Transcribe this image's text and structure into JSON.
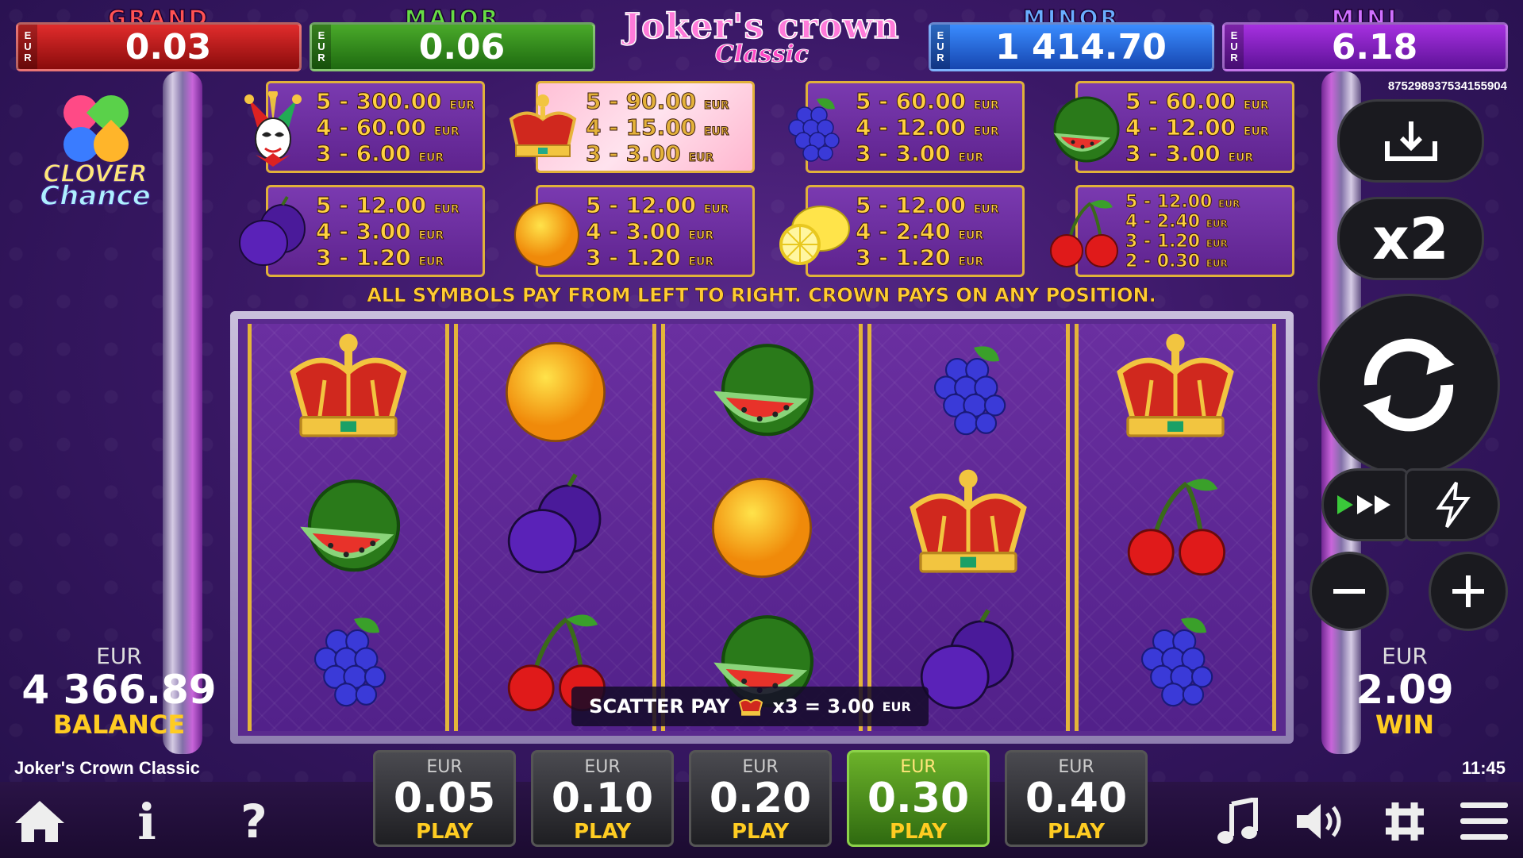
{
  "jackpots": [
    {
      "name": "GRAND",
      "currency_top": "E",
      "currency_mid": "U",
      "currency_bot": "R",
      "value": "0.03"
    },
    {
      "name": "MAJOR",
      "currency_top": "E",
      "currency_mid": "U",
      "currency_bot": "R",
      "value": "0.06"
    },
    {
      "name": "MINOR",
      "currency_top": "E",
      "currency_mid": "U",
      "currency_bot": "R",
      "value": "1 414.70"
    },
    {
      "name": "MINI",
      "currency_top": "E",
      "currency_mid": "U",
      "currency_bot": "R",
      "value": "6.18"
    }
  ],
  "logo": {
    "line1": "Joker's crown",
    "line2": "Classic"
  },
  "clover_logo": {
    "line1": "CLOVER",
    "line2": "Chance"
  },
  "ticket_id": "875298937534155904",
  "paytable": [
    {
      "symbol": "joker-icon",
      "lines": [
        "5 - 300.00",
        "4 - 60.00",
        "3 - 6.00"
      ],
      "unit": "EUR"
    },
    {
      "symbol": "crown-icon",
      "lines": [
        "5 - 90.00",
        "4 - 15.00",
        "3 - 3.00"
      ],
      "unit": "EUR"
    },
    {
      "symbol": "grapes-icon",
      "lines": [
        "5 - 60.00",
        "4 - 12.00",
        "3 - 3.00"
      ],
      "unit": "EUR"
    },
    {
      "symbol": "watermelon-icon",
      "lines": [
        "5 - 60.00",
        "4 - 12.00",
        "3 - 3.00"
      ],
      "unit": "EUR"
    },
    {
      "symbol": "plum-icon",
      "lines": [
        "5 - 12.00",
        "4 - 3.00",
        "3 - 1.20"
      ],
      "unit": "EUR"
    },
    {
      "symbol": "orange-icon",
      "lines": [
        "5 - 12.00",
        "4 - 3.00",
        "3 - 1.20"
      ],
      "unit": "EUR"
    },
    {
      "symbol": "lemon-icon",
      "lines": [
        "5 - 12.00",
        "4 - 2.40",
        "3 - 1.20"
      ],
      "unit": "EUR"
    },
    {
      "symbol": "cherry-icon",
      "lines": [
        "5 - 12.00",
        "4 - 2.40",
        "3 - 1.20",
        "2 - 0.30"
      ],
      "unit": "EUR"
    }
  ],
  "rule_text": "ALL SYMBOLS PAY FROM LEFT TO RIGHT. CROWN PAYS ON ANY POSITION.",
  "reels": [
    [
      "crown",
      "watermelon",
      "grapes"
    ],
    [
      "orange",
      "plum",
      "cherry"
    ],
    [
      "watermelon",
      "orange",
      "watermelon"
    ],
    [
      "grapes",
      "crown",
      "plum"
    ],
    [
      "crown",
      "cherry",
      "grapes"
    ]
  ],
  "scatter": {
    "label": "SCATTER PAY",
    "multiplier": "x3 = 3.00",
    "unit": "EUR"
  },
  "balance": {
    "currency": "EUR",
    "value": "4 366.89",
    "label": "BALANCE"
  },
  "win": {
    "currency": "EUR",
    "value": "2.09",
    "label": "WIN"
  },
  "controls": {
    "multiplier_label": "x2"
  },
  "game_title": "Joker's Crown Classic",
  "clock": "11:45",
  "bets": [
    {
      "currency": "EUR",
      "value": "0.05",
      "label": "PLAY",
      "active": false
    },
    {
      "currency": "EUR",
      "value": "0.10",
      "label": "PLAY",
      "active": false
    },
    {
      "currency": "EUR",
      "value": "0.20",
      "label": "PLAY",
      "active": false
    },
    {
      "currency": "EUR",
      "value": "0.30",
      "label": "PLAY",
      "active": true
    },
    {
      "currency": "EUR",
      "value": "0.40",
      "label": "PLAY",
      "active": false
    }
  ],
  "bottom_icons": {
    "info": "i",
    "help": "?"
  },
  "colors": {
    "gold": "#ffcc22",
    "active_bet": "#6cb22a",
    "grand": "#e12c2c",
    "major": "#4aaa2a",
    "minor": "#3a8cff",
    "mini": "#a630e0"
  }
}
